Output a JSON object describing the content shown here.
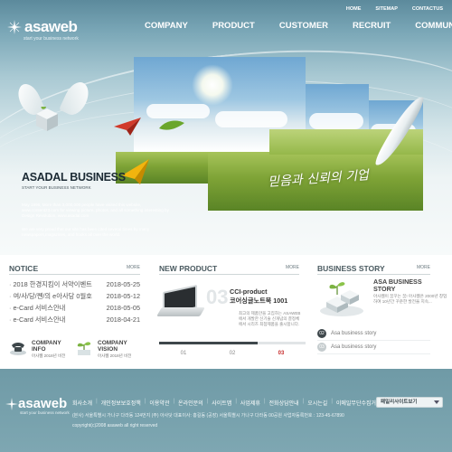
{
  "header": {
    "logo_text": "asaweb",
    "logo_sub": "start your business network",
    "util_nav": [
      "HOME",
      "SITEMAP",
      "CONTACTUS"
    ],
    "main_nav": [
      "COMPANY",
      "PRODUCT",
      "CUSTOMER",
      "RECRUIT",
      "COMMUNITY"
    ]
  },
  "hero": {
    "brand_title": "ASADAL BUSINESS",
    "brand_sub": "START YOUR BUSINESS NETWORK",
    "desc1": "May 1998, More than 3,000,000 people have visited this website, www.content23.com for viewing picture, photos, and all something interesting by Design Revolution, www.asadal.com",
    "desc2": "We are very proud that our site has been cited several times by many newspapers,magazines, and hooks all over the world.",
    "slogan": "믿음과 신뢰의 기업"
  },
  "notice": {
    "title": "NOTICE",
    "more": "MORE",
    "items": [
      {
        "title": "2018 한경지킴이 서약이벤트",
        "date": "2018-05-25"
      },
      {
        "title": "여/사/당/쪤/의 e아사당 0월호",
        "date": "2018-05-12"
      },
      {
        "title": "e-Card 서비스안내",
        "date": "2018-05-05"
      },
      {
        "title": "e-Card 서비스안내",
        "date": "2018-04-21"
      }
    ],
    "company_info": {
      "title": "COMPANY INFO",
      "sub": "아사웹 2018년 비전"
    },
    "company_vision": {
      "title": "COMPANY VISION",
      "sub": "아사웹 2018년 비전"
    }
  },
  "new_product": {
    "title": "NEW PRODUCT",
    "more": "MORE",
    "number": "03",
    "product_name": "CCI-product",
    "product_sub": "코어싱글노트북 1001",
    "desc": "최고의 제품만을 고집하는 ASAWEB에서 개발한 신기술 신개념의 결정체에서 시리즈 최첨제품을 출시합니다.",
    "progress": 0.67,
    "pages": [
      "01",
      "02",
      "03"
    ],
    "active_page": 2
  },
  "business_story": {
    "title": "BUSINESS STORY",
    "more": "MORE",
    "story_title": "ASA BUSINESS STORY",
    "desc": "아사웹이 꿈꾸는 꿈! 아사웹은 2000년 창업하여 10년간 꾸준한 발전을 지속...",
    "list": [
      {
        "num": "02",
        "label": "Asa business story"
      },
      {
        "num": "03",
        "label": "Asa business story"
      }
    ]
  },
  "footer": {
    "logo_text": "asaweb",
    "logo_sub": "start your business network",
    "links": [
      "회사소개",
      "개인정보보호정책",
      "이용약관",
      "온라인문의",
      "사이트맵",
      "사업제휴",
      "전화상담안내",
      "오시는길",
      "이메일무단수집거부"
    ],
    "address": "(본사) 서울특별시 가나구 다라동 124번지 (주) 아사닷 대표이사: 홍길동 (공장) 서울특별시 가나구 다라동 00공원 사업자등록번호 : 123-45-67890",
    "copyright": "copyright(c)2008 asaweb all right reserved",
    "family_select": "패밀리사이트보기"
  },
  "colors": {
    "hero_top": "#5c8a9c",
    "footer_bg": "#7ea7b2",
    "accent_red": "#c62828",
    "dark": "#3e474b"
  }
}
